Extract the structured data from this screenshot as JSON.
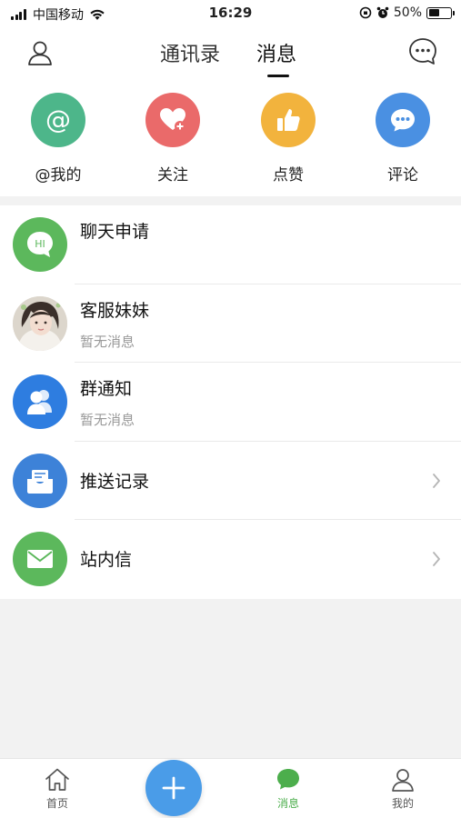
{
  "status_bar": {
    "carrier": "中国移动",
    "time": "16:29",
    "battery_percent": "50%",
    "battery_level": 0.5
  },
  "nav": {
    "tab_contacts": "通讯录",
    "tab_messages": "消息"
  },
  "quick_actions": [
    {
      "label": "@我的",
      "icon": "at-icon",
      "color": "#4db68a"
    },
    {
      "label": "关注",
      "icon": "heart-plus-icon",
      "color": "#ea6a6a"
    },
    {
      "label": "点赞",
      "icon": "thumbs-up-icon",
      "color": "#f2b33d"
    },
    {
      "label": "评论",
      "icon": "comment-bubble-icon",
      "color": "#4a90e2"
    }
  ],
  "messages": [
    {
      "title": "聊天申请",
      "subtitle": "",
      "avatar_text": "HI",
      "icon": "hi-bubble-icon",
      "color": "#5cb85c"
    },
    {
      "title": "客服妹妹",
      "subtitle": "暂无消息",
      "icon": "customer-service-avatar",
      "color": "#d9cfc4"
    },
    {
      "title": "群通知",
      "subtitle": "暂无消息",
      "icon": "group-icon",
      "color": "#2e7de0"
    },
    {
      "title": "推送记录",
      "subtitle": "",
      "icon": "push-record-icon",
      "color": "#3d82d8"
    },
    {
      "title": "站内信",
      "subtitle": "",
      "icon": "envelope-icon",
      "color": "#5cb85c"
    }
  ],
  "bottom_tabs": [
    {
      "label": "首页",
      "icon": "home-icon"
    },
    {
      "label": "消息",
      "icon": "message-icon",
      "active": true
    },
    {
      "label": "我的",
      "icon": "user-icon"
    }
  ],
  "colors": {
    "active_green": "#4cae4c",
    "fab_blue": "#4a9ce8"
  }
}
